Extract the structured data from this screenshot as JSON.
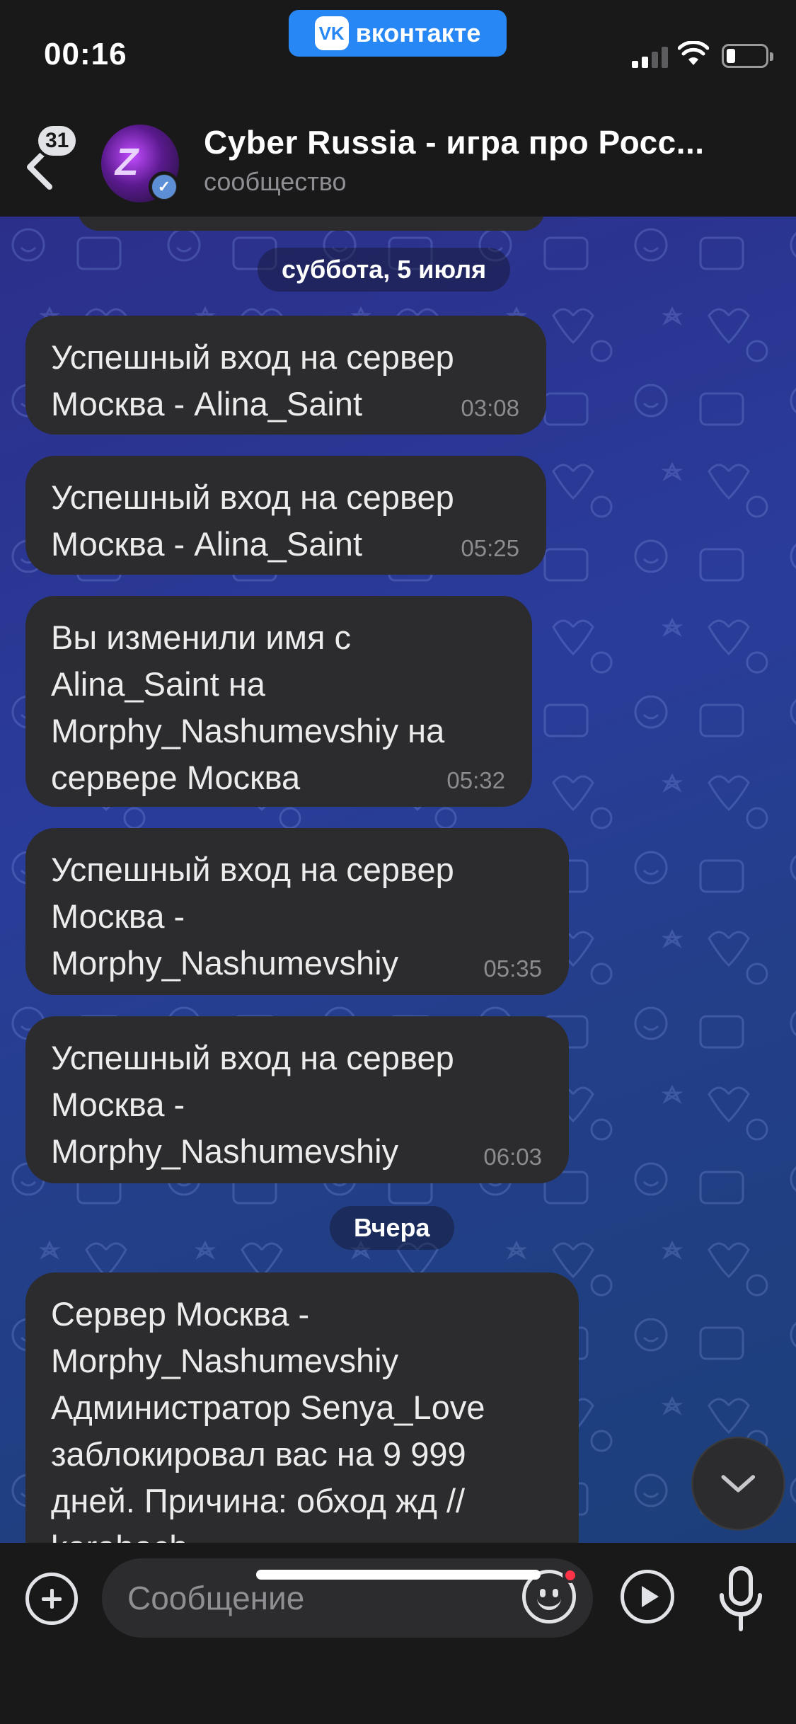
{
  "status_bar": {
    "time": "00:16",
    "app_badge": "вконтакте",
    "app_logo": "vk",
    "signal_icon": "cellular-signal-icon",
    "wifi_icon": "wifi-icon",
    "battery_icon": "battery-low-icon",
    "battery_level": 0.15
  },
  "header": {
    "back_badge": "31",
    "title": "Cyber Russia - игра про Росс...",
    "subtitle": "сообщество",
    "verified": true
  },
  "chat": {
    "dates": {
      "saturday": "суббота, 5 июля",
      "yesterday": "Вчера"
    },
    "messages": [
      {
        "text": "Успешный вход на сервер\nМосква - Alina_Saint",
        "time": "03:08"
      },
      {
        "text": "Успешный вход на сервер\nМосква - Alina_Saint",
        "time": "05:25"
      },
      {
        "text": "Вы изменили имя с\nAlina_Saint на\nMorphy_Nashumevshiy на\nсервере Москва",
        "time": "05:32"
      },
      {
        "text": "Успешный вход на сервер\nМосква -\nMorphy_Nashumevshiy",
        "time": "05:35"
      },
      {
        "text": "Успешный вход на сервер\nМосква -\nMorphy_Nashumevshiy",
        "time": "06:03"
      },
      {
        "text": "Сервер Москва -\nMorphy_Nashumevshiy\nАдминистратор Senya_Love\nзаблокировал вас на 9 999\nдней. Причина: обход жд //\nkarabach",
        "time": ""
      }
    ]
  },
  "input": {
    "placeholder": "Сообщение"
  },
  "colors": {
    "accent": "#2787f5",
    "bubble": "#2c2c2e",
    "bar": "#19191a",
    "notification_dot": "#ff3347"
  }
}
